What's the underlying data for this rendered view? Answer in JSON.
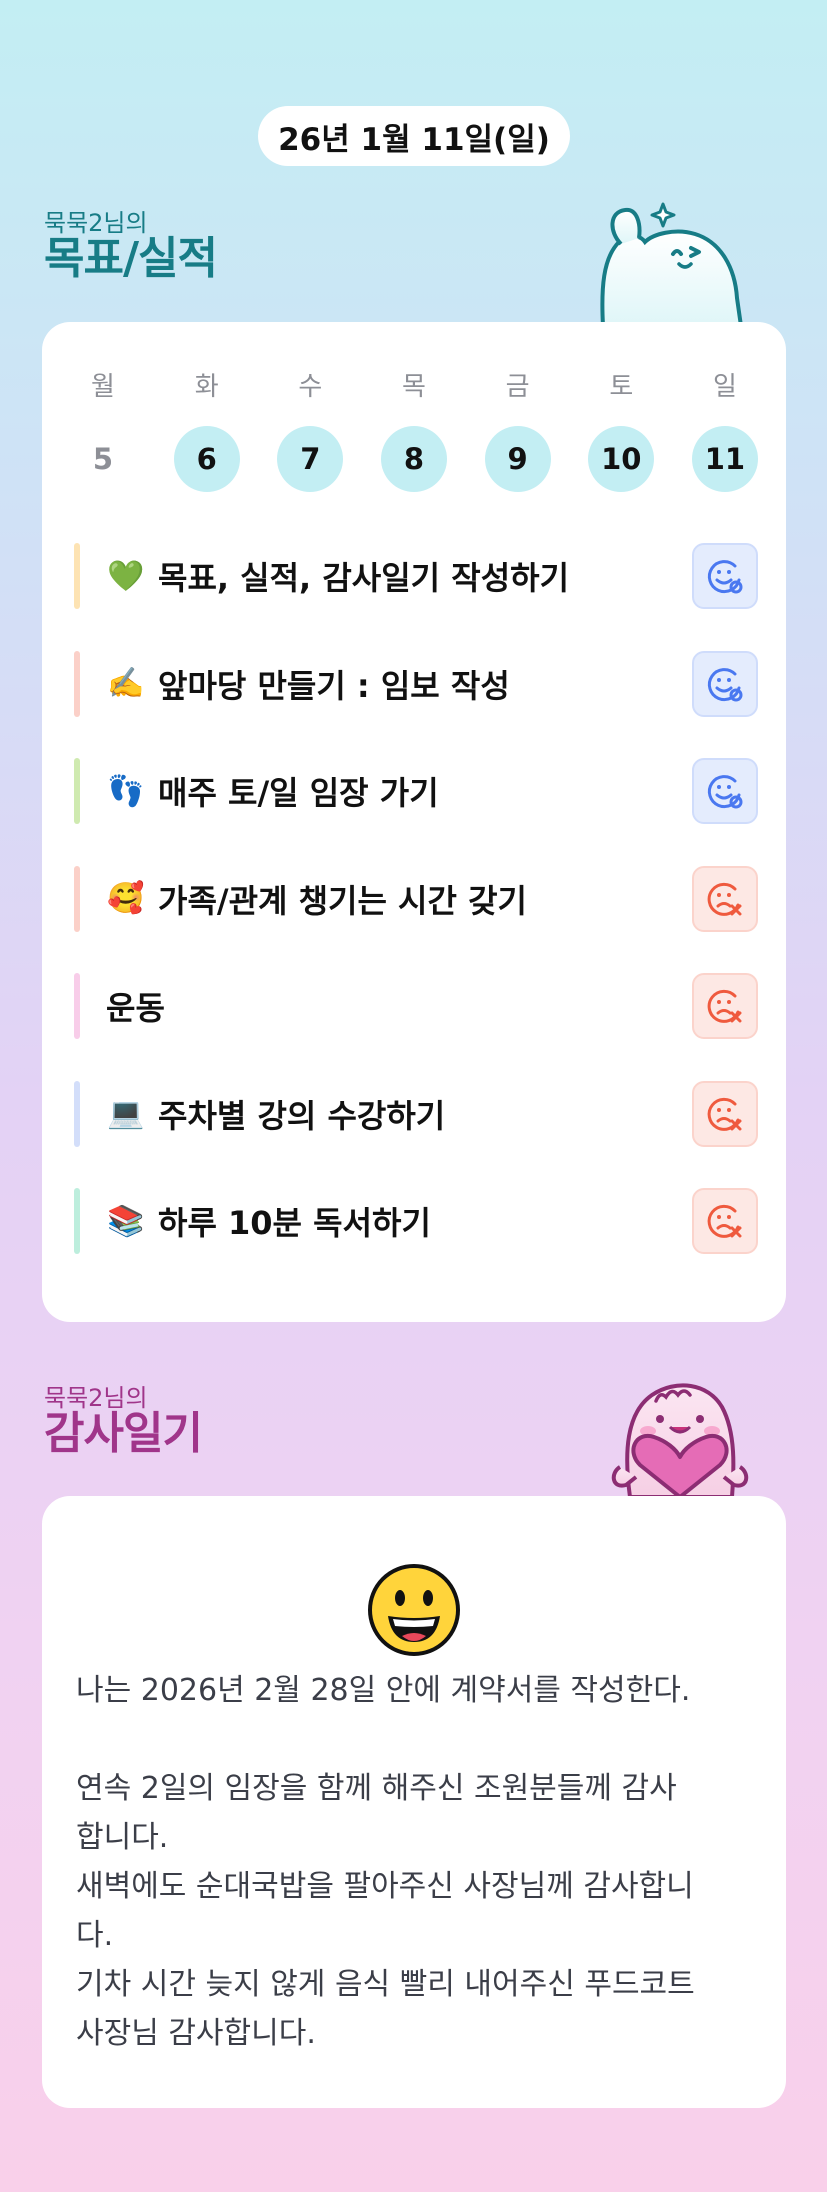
{
  "date_label": "26년 1월 11일(일)",
  "goals_section": {
    "owner": "묵묵2님의",
    "title": "목표/실적"
  },
  "week": [
    {
      "day": "월",
      "num": "5",
      "state": "inactive"
    },
    {
      "day": "화",
      "num": "6",
      "state": "active"
    },
    {
      "day": "수",
      "num": "7",
      "state": "active"
    },
    {
      "day": "목",
      "num": "8",
      "state": "active"
    },
    {
      "day": "금",
      "num": "9",
      "state": "active"
    },
    {
      "day": "토",
      "num": "10",
      "state": "active"
    },
    {
      "day": "일",
      "num": "11",
      "state": "active"
    }
  ],
  "goals": [
    {
      "icon": "green-heart-icon",
      "emoji": "💚",
      "label": "목표, 실적, 감사일기 작성하기",
      "bar_color": "#fde3b3",
      "status": "done"
    },
    {
      "icon": "writing-hand-icon",
      "emoji": "✍️",
      "label": "앞마당 만들기 : 임보 작성",
      "bar_color": "#fbd0c8",
      "status": "done"
    },
    {
      "icon": "footprints-icon",
      "emoji": "👣",
      "label": "매주 토/일 임장 가기",
      "bar_color": "#cfeab0",
      "status": "done"
    },
    {
      "icon": "smiling-face-with-hearts-icon",
      "emoji": "🥰",
      "label": "가족/관계 챙기는 시간 갖기",
      "bar_color": "#fbd0c8",
      "status": "miss"
    },
    {
      "icon": "",
      "emoji": "",
      "label": "운동",
      "bar_color": "#f8cde9",
      "status": "miss"
    },
    {
      "icon": "laptop-icon",
      "emoji": "💻",
      "label": "주차별 강의 수강하기",
      "bar_color": "#d3defa",
      "status": "miss"
    },
    {
      "icon": "books-icon",
      "emoji": "📚",
      "label": "하루 10분 독서하기",
      "bar_color": "#bdeedd",
      "status": "miss"
    }
  ],
  "status_colors": {
    "done": "#4a78f0",
    "miss": "#ef5a3e"
  },
  "thanks_section": {
    "owner": "묵묵2님의",
    "title": "감사일기"
  },
  "diary": {
    "mood_icon": "grinning-face-icon",
    "lines": [
      "나는 2026년 2월 28일 안에 계약서를 작성한다.",
      "",
      "연속 2일의 임장을 함께 해주신 조원분들께 감사",
      "합니다.",
      "새벽에도 순대국밥을 팔아주신 사장님께 감사합니",
      "다.",
      "기차 시간 늦지 않게 음식 빨리 내어주신 푸드코트",
      "사장님 감사합니다."
    ]
  }
}
